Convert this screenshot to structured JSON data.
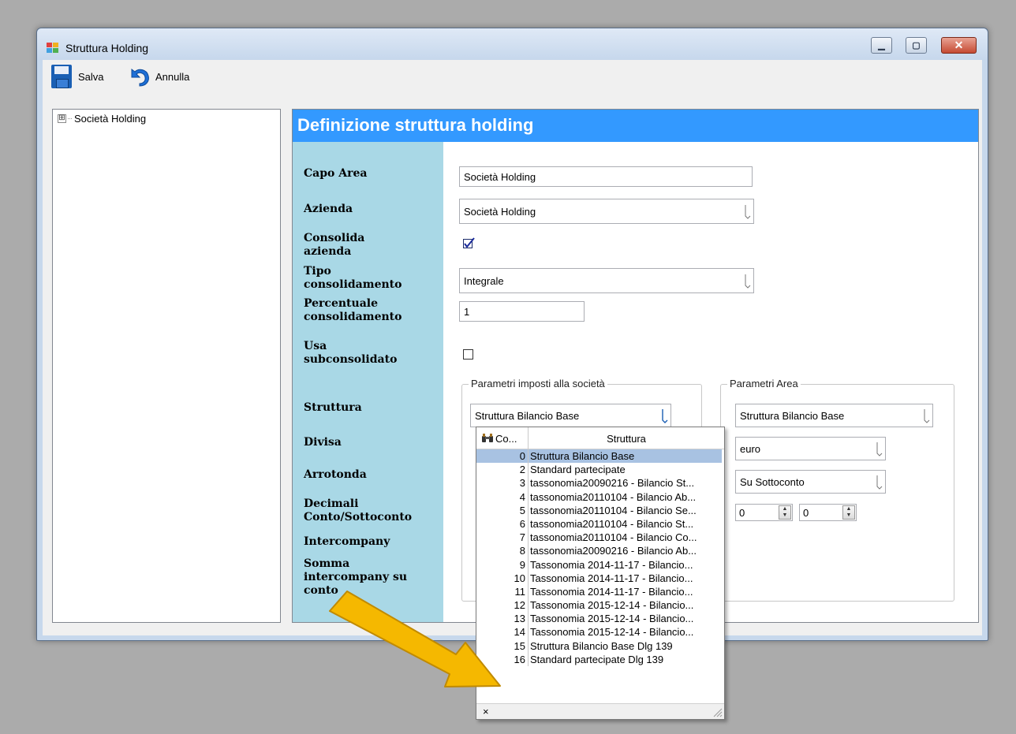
{
  "window": {
    "title": "Struttura Holding"
  },
  "toolbar": {
    "save_label": "Salva",
    "undo_label": "Annulla"
  },
  "tree": {
    "items": [
      {
        "label": "Società Holding",
        "expander": "⊞"
      }
    ]
  },
  "main": {
    "header": "Definizione struttura holding",
    "labels": {
      "capo_area": "Capo Area",
      "azienda": "Azienda",
      "consolida": "Consolida\nazienda",
      "tipo": "Tipo\nconsolidamento",
      "percentuale": "Percentuale\nconsolidamento",
      "usa_sub": "Usa\nsubconsolidato",
      "struttura": "Struttura",
      "divisa": "Divisa",
      "arrotonda": "Arrotonda",
      "decimali": "Decimali\nConto/Sottoconto",
      "intercompany": "Intercompany",
      "somma": "Somma\nintercompany su\nconto"
    },
    "fields": {
      "capo_area": "Società Holding",
      "azienda": "Società Holding",
      "consolida_checked": true,
      "tipo": "Integrale",
      "percentuale": "1",
      "usa_sub_checked": false
    },
    "group_societa": {
      "title": "Parametri imposti alla società",
      "struttura": "Struttura Bilancio Base"
    },
    "group_area": {
      "title": "Parametri Area",
      "struttura": "Struttura Bilancio Base",
      "divisa": "euro",
      "arrotonda": "Su Sottoconto",
      "decimali_conto": "0",
      "decimali_sottoconto": "0"
    }
  },
  "dropdown": {
    "header_code": "Co...",
    "header_name": "Struttura",
    "footer": "×",
    "rows": [
      {
        "code": "0",
        "name": "Struttura Bilancio Base",
        "selected": true
      },
      {
        "code": "2",
        "name": "Standard partecipate"
      },
      {
        "code": "3",
        "name": "tassonomia20090216 - Bilancio St..."
      },
      {
        "code": "4",
        "name": "tassonomia20110104 - Bilancio Ab..."
      },
      {
        "code": "5",
        "name": "tassonomia20110104 - Bilancio Se..."
      },
      {
        "code": "6",
        "name": "tassonomia20110104 - Bilancio St..."
      },
      {
        "code": "7",
        "name": "tassonomia20110104 - Bilancio Co..."
      },
      {
        "code": "8",
        "name": "tassonomia20090216 - Bilancio Ab..."
      },
      {
        "code": "9",
        "name": "Tassonomia 2014-11-17 - Bilancio..."
      },
      {
        "code": "10",
        "name": "Tassonomia 2014-11-17 - Bilancio..."
      },
      {
        "code": "11",
        "name": "Tassonomia 2014-11-17 - Bilancio..."
      },
      {
        "code": "12",
        "name": "Tassonomia 2015-12-14 - Bilancio..."
      },
      {
        "code": "13",
        "name": "Tassonomia 2015-12-14 - Bilancio..."
      },
      {
        "code": "14",
        "name": "Tassonomia 2015-12-14 - Bilancio..."
      },
      {
        "code": "15",
        "name": "Struttura Bilancio Base Dlg 139"
      },
      {
        "code": "16",
        "name": "Standard partecipate Dlg 139"
      }
    ]
  },
  "colors": {
    "header_bg": "#3399ff",
    "label_col_bg": "#a9d8e6",
    "selected_row": "#a8c2e2",
    "arrow": "#f5b800"
  },
  "icons": [
    "app-icon",
    "save-icon",
    "undo-icon",
    "minimize-icon",
    "maximize-icon",
    "close-icon",
    "expander-icon",
    "binoculars-icon",
    "dropdown-arrow-icon",
    "resize-grip-icon",
    "annotation-arrow-icon"
  ]
}
